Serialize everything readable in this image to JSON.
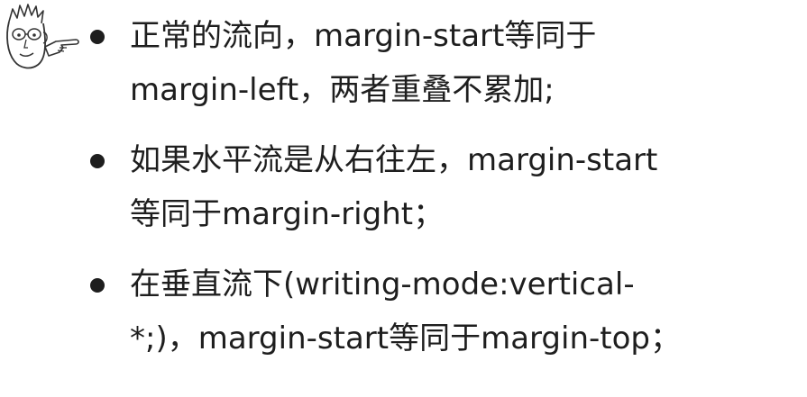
{
  "bullets": [
    {
      "lines": [
        "正常的流向，margin-start等同于",
        "margin-left，两者重叠不累加;"
      ]
    },
    {
      "lines": [
        "如果水平流是从右往左，margin-start",
        "等同于margin-right；"
      ]
    },
    {
      "lines": [
        "在垂直流下(writing-mode:vertical-",
        "*;)，margin-start等同于margin-top；"
      ]
    }
  ],
  "mascot": {
    "icon": "cartoon-face-pointing-icon"
  },
  "colors": {
    "text": "#1e1e1e",
    "background": "#ffffff"
  }
}
